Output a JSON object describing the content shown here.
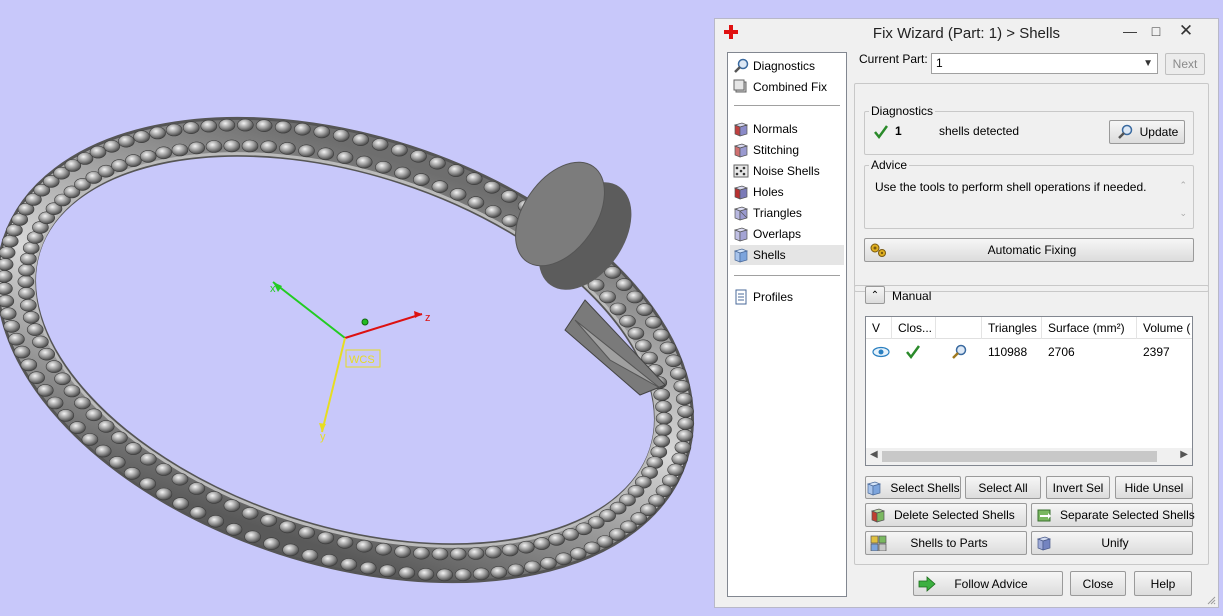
{
  "window": {
    "title": "Fix Wizard (Part: 1) > Shells"
  },
  "viewport": {
    "axis_labels": {
      "x": "x",
      "y": "y",
      "z": "z"
    },
    "wcs_label": "WCS"
  },
  "nav": {
    "items": [
      {
        "label": "Diagnostics",
        "icon": "magnifier-icon"
      },
      {
        "label": "Combined Fix",
        "icon": "combined-fix-icon"
      },
      {
        "label": "Normals",
        "icon": "normals-cube-icon"
      },
      {
        "label": "Stitching",
        "icon": "stitching-cube-icon"
      },
      {
        "label": "Noise Shells",
        "icon": "noise-shells-icon"
      },
      {
        "label": "Holes",
        "icon": "holes-cube-icon"
      },
      {
        "label": "Triangles",
        "icon": "triangles-cube-icon"
      },
      {
        "label": "Overlaps",
        "icon": "overlaps-cube-icon"
      },
      {
        "label": "Shells",
        "icon": "shells-cube-icon",
        "selected": true
      },
      {
        "label": "Profiles",
        "icon": "document-icon"
      }
    ]
  },
  "current_part": {
    "label": "Current Part:",
    "value": "1",
    "next_label": "Next"
  },
  "diagnostics": {
    "title": "Diagnostics",
    "count": "1",
    "text": "shells detected",
    "update_label": "Update"
  },
  "advice": {
    "title": "Advice",
    "text": "Use the tools to perform shell operations if needed.",
    "automatic_fixing_label": "Automatic Fixing"
  },
  "manual": {
    "title": "Manual",
    "columns": [
      "V",
      "Clos...",
      "",
      "Triangles",
      "Surface (mm²)",
      "Volume ("
    ],
    "rows": [
      {
        "triangles": "110988",
        "surface": "2706",
        "volume": "2397"
      }
    ]
  },
  "buttons": {
    "select_shells": "Select Shells",
    "select_all": "Select All",
    "invert_sel": "Invert Sel",
    "hide_unsel": "Hide Unsel",
    "delete_selected": "Delete Selected Shells",
    "separate_selected": "Separate Selected Shells",
    "shells_to_parts": "Shells to Parts",
    "unify": "Unify",
    "follow_advice": "Follow Advice",
    "close": "Close",
    "help": "Help"
  },
  "colors": {
    "viewport_bg": "#c8c8fa",
    "x_axis": "#22cc22",
    "z_axis": "#dd1111",
    "y_axis": "#e6dd22",
    "check_green": "#2a8a2a",
    "eye_blue": "#2a7fc0"
  }
}
